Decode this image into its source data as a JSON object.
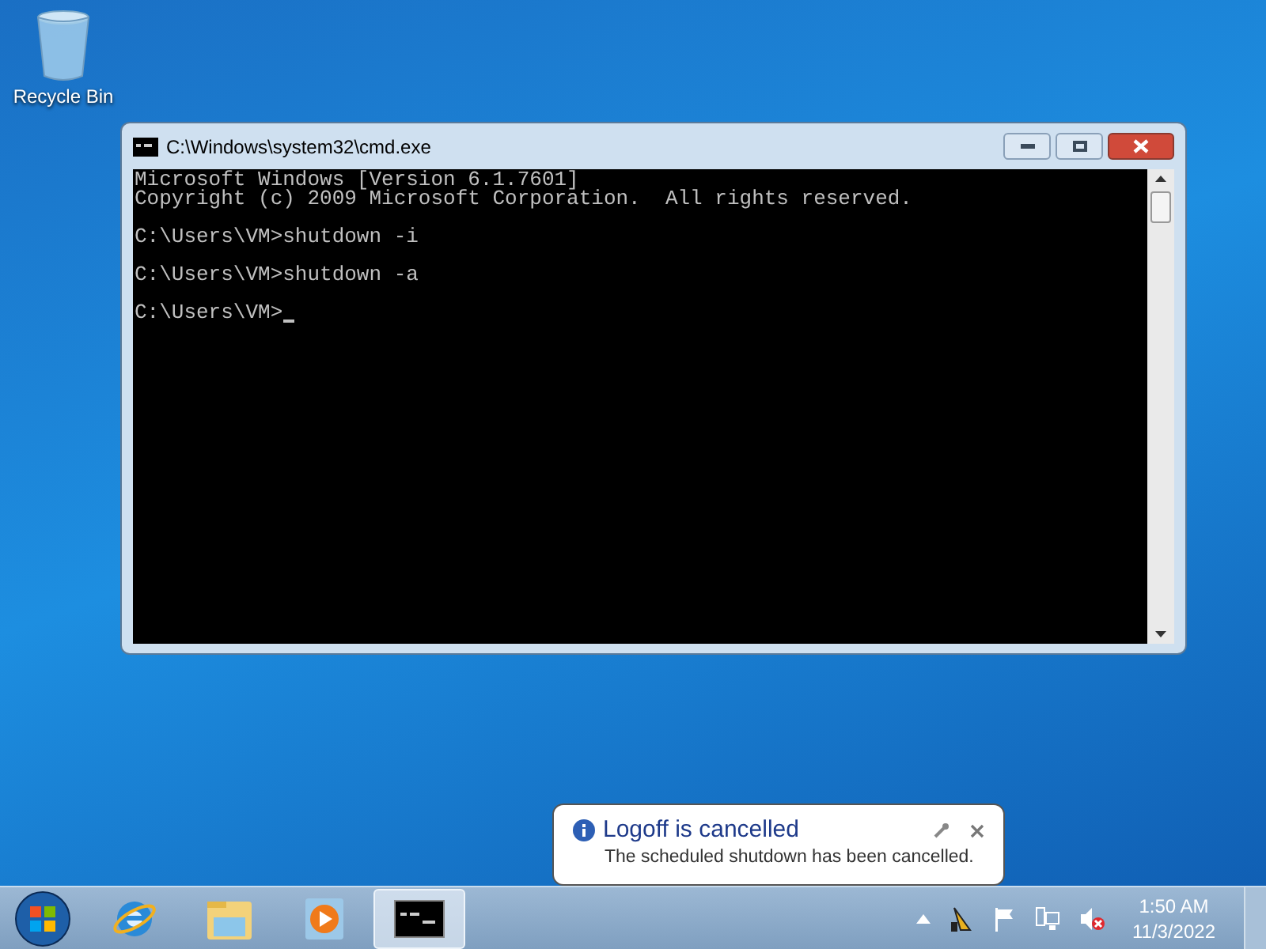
{
  "desktop_icons": [
    {
      "label": "Recycle Bin"
    }
  ],
  "window": {
    "title": "C:\\Windows\\system32\\cmd.exe",
    "console_blocks": [
      [
        "Microsoft Windows [Version 6.1.7601]",
        "Copyright (c) 2009 Microsoft Corporation.  All rights reserved."
      ],
      [
        "C:\\Users\\VM>shutdown -i"
      ],
      [
        "C:\\Users\\VM>shutdown -a"
      ],
      [
        "C:\\Users\\VM>"
      ]
    ]
  },
  "notification": {
    "title": "Logoff is cancelled",
    "message": "The scheduled shutdown has been cancelled."
  },
  "taskbar": {
    "items": [
      {
        "kind": "start",
        "selected": false
      },
      {
        "kind": "browser",
        "selected": false
      },
      {
        "kind": "folder",
        "selected": false
      },
      {
        "kind": "media",
        "selected": false
      },
      {
        "kind": "console",
        "selected": true
      }
    ],
    "tray": [
      {
        "kind": "arrow"
      },
      {
        "kind": "shutdown"
      },
      {
        "kind": "flag"
      },
      {
        "kind": "network"
      },
      {
        "kind": "volume"
      }
    ],
    "time": "1:50 AM",
    "date": "11/3/2022"
  }
}
